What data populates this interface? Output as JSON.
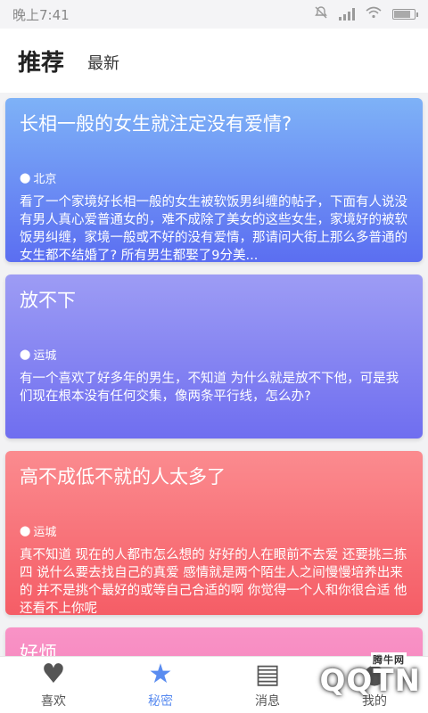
{
  "status_bar": {
    "time": "晚上7:41"
  },
  "header": {
    "active_tab": "推荐",
    "other_tab": "最新"
  },
  "cards": [
    {
      "title": "长相一般的女生就注定没有爱情?",
      "location": "北京",
      "body": "看了一个家境好长相一般的女生被软饭男纠缠的帖子，下面有人说没有男人真心爱普通女的，难不成除了美女的这些女生，家境好的被软饭男纠缠，家境一般或不好的没有爱情，那请问大街上那么多普通的女生都不结婚了? 所有男生都娶了9分美...",
      "gradient_top": "#7eb2f7",
      "gradient_bottom": "#5b6ef1"
    },
    {
      "title": "放不下",
      "location": "运城",
      "body": "有一个喜欢了好多年的男生，不知道 为什么就是放不下他，可是我们现在根本没有任何交集，像两条平行线，怎么办?",
      "gradient_top": "#9d9cf4",
      "gradient_bottom": "#6f6ef0"
    },
    {
      "title": "高不成低不就的人太多了",
      "location": "运城",
      "body": "真不知道 现在的人都市怎么想的 好好的人在眼前不去爱 还要挑三拣四 说什么要去找自己的真爱 感情就是两个陌生人之间慢慢培养出来的 并不是挑个最好的或等自己合适的啊 你觉得一个人和你很合适 他还看不上你呢",
      "gradient_top": "#fb8b8f",
      "gradient_bottom": "#f55d66"
    },
    {
      "title": "好烦",
      "location": "",
      "body": "",
      "gradient_top": "#f993c6",
      "gradient_bottom": "#f27cb8"
    }
  ],
  "bottom_nav": [
    {
      "label": "喜欢",
      "icon": "heart-icon",
      "glyph": "♥",
      "active": false
    },
    {
      "label": "秘密",
      "icon": "star-icon",
      "glyph": "★",
      "active": true
    },
    {
      "label": "消息",
      "icon": "message-icon",
      "glyph": "▤",
      "active": false
    },
    {
      "label": "我的",
      "icon": "profile-icon",
      "glyph": "●",
      "active": false
    }
  ],
  "watermark": {
    "text": "QQTN",
    "small": "腾牛网"
  }
}
